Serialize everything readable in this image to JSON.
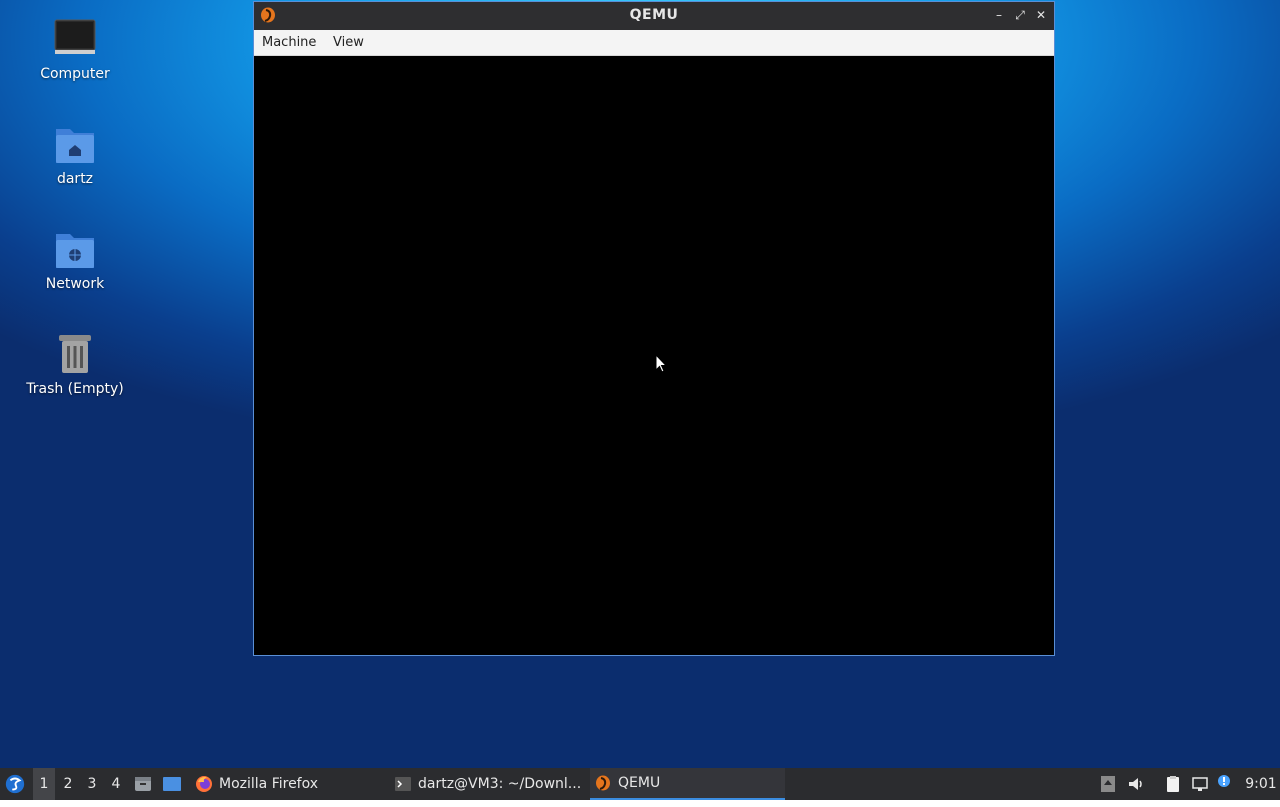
{
  "desktop": {
    "icons": [
      {
        "label": "Computer"
      },
      {
        "label": "dartz"
      },
      {
        "label": "Network"
      },
      {
        "label": "Trash (Empty)"
      }
    ]
  },
  "window": {
    "title": "QEMU",
    "menu": [
      "Machine",
      "View"
    ],
    "controls": {
      "minimize": "–",
      "maximize": "⤢",
      "close": "✕"
    }
  },
  "taskbar": {
    "workspaces": [
      "1",
      "2",
      "3",
      "4"
    ],
    "active_workspace": "1",
    "tasks": [
      {
        "label": "Mozilla Firefox",
        "icon": "firefox-icon"
      },
      {
        "label": "dartz@VM3: ~/Downl...",
        "icon": "terminal-icon"
      },
      {
        "label": "QEMU",
        "icon": "qemu-icon"
      }
    ],
    "clock": "9:01"
  },
  "colors": {
    "taskbar": "#2b2c2f",
    "window_border": "#5a8fd6",
    "active_task_underline": "#3b8de0"
  }
}
